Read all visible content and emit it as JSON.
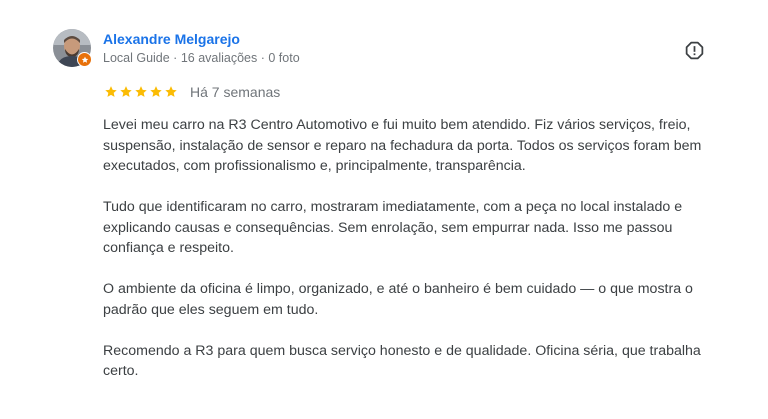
{
  "reviewer": {
    "name": "Alexandre Melgarejo",
    "meta": "Local Guide · 16 avaliações · 0 foto",
    "avatar_icon": "person-avatar",
    "badge_icon": "local-guide-star-icon"
  },
  "rating": {
    "stars": 5,
    "max_stars": 5,
    "star_color": "#fbbc04",
    "date": "Há 7 semanas"
  },
  "actions": {
    "report_icon": "report-flag-icon"
  },
  "review": {
    "paragraphs": [
      "Levei meu carro na R3 Centro Automotivo e fui muito bem atendido. Fiz vários serviços, freio, suspensão, instalação de sensor e reparo na fechadura da porta. Todos os serviços foram bem executados, com profissionalismo e, principalmente, transparência.",
      "Tudo que identificaram no carro, mostraram imediatamente, com a peça no local instalado e explicando causas e consequências. Sem enrolação, sem empurrar nada. Isso me passou confiança e respeito.",
      "O ambiente da oficina é limpo, organizado, e até o banheiro é bem cuidado — o que mostra o padrão que eles seguem em tudo.",
      "Recomendo a R3 para quem busca serviço honesto e de qualidade. Oficina séria, que trabalha certo."
    ]
  },
  "colors": {
    "name_link": "#1a73e8",
    "meta_text": "#70757a",
    "body_text": "#3c4043",
    "badge": "#e8710a"
  }
}
